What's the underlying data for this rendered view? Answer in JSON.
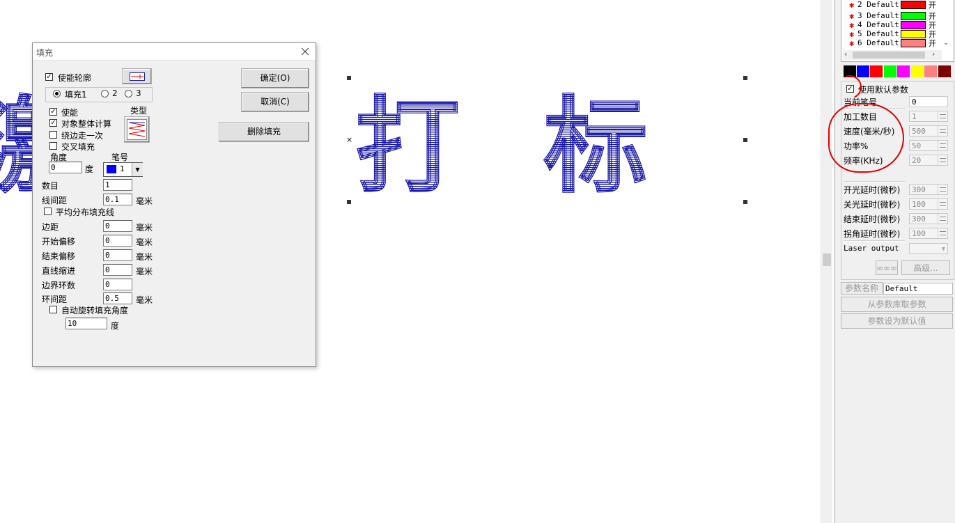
{
  "canvas": {
    "text": "激光打标",
    "hatch_color": "#1a1aa8"
  },
  "pens": [
    {
      "label": "2 Default",
      "color": "#ff0000",
      "state": "开"
    },
    {
      "label": "3 Default",
      "color": "#00ff00",
      "state": "开"
    },
    {
      "label": "4 Default",
      "color": "#ff00ff",
      "state": "开"
    },
    {
      "label": "5 Default",
      "color": "#ffff00",
      "state": "开"
    },
    {
      "label": "6 Default",
      "color": "#ff8080",
      "state": "开"
    }
  ],
  "palette": [
    "#000000",
    "#0000ff",
    "#ff0000",
    "#00ff00",
    "#ff00ff",
    "#ffff00",
    "#ff8080",
    "#800000"
  ],
  "params": {
    "use_default_label": "使用默认参数",
    "use_default_checked": true,
    "current_pen_label": "当前笔号",
    "current_pen_value": "0",
    "count_label": "加工数目",
    "count_value": "1",
    "speed_label": "速度(毫米/秒)",
    "speed_value": "500",
    "power_label": "功率%",
    "power_value": "50",
    "freq_label": "频率(KHz)",
    "freq_value": "20",
    "on_delay_label": "开光延时(微秒)",
    "on_delay_value": "300",
    "off_delay_label": "关光延时(微秒)",
    "off_delay_value": "100",
    "end_delay_label": "结束延时(微秒)",
    "end_delay_value": "300",
    "corner_delay_label": "拐角延时(微秒)",
    "corner_delay_value": "100",
    "laser_output_label": "Laser output",
    "wobble_button": "∞∞∞",
    "advanced_button": "高级...",
    "param_name_label": "参数名称",
    "param_name_value": "Default",
    "load_button": "从参数库取参数",
    "set_default_button": "参数设为默认值"
  },
  "dialog": {
    "title": "填充",
    "enable_contour_label": "使能轮廓",
    "enable_contour_checked": true,
    "fill_tabs": [
      "填充1",
      "2",
      "3"
    ],
    "fill_tab_selected": 0,
    "enable_label": "使能",
    "enable_checked": true,
    "whole_calc_label": "对象整体计算",
    "whole_calc_checked": true,
    "edge_once_label": "绕边走一次",
    "edge_once_checked": false,
    "cross_fill_label": "交叉填充",
    "cross_fill_checked": false,
    "type_label": "类型",
    "angle_label": "角度",
    "angle_value": "0",
    "degree_unit": "度",
    "pen_label": "笔号",
    "pen_value": "1",
    "pen_color": "#0000ff",
    "count_label": "数目",
    "count_value": "1",
    "line_spacing_label": "线间距",
    "line_spacing_value": "0.1",
    "mm_unit": "毫米",
    "even_dist_label": "平均分布填充线",
    "even_dist_checked": false,
    "margin_label": "边距",
    "margin_value": "0",
    "start_offset_label": "开始偏移",
    "start_offset_value": "0",
    "end_offset_label": "结束偏移",
    "end_offset_value": "0",
    "line_indent_label": "直线缩进",
    "line_indent_value": "0",
    "border_loops_label": "边界环数",
    "border_loops_value": "0",
    "loop_spacing_label": "环间距",
    "loop_spacing_value": "0.5",
    "auto_rotate_label": "自动旋转填充角度",
    "auto_rotate_checked": false,
    "auto_rotate_value": "10",
    "ok_button": "确定(O)",
    "cancel_button": "取消(C)",
    "delete_fill_button": "删除填充"
  }
}
